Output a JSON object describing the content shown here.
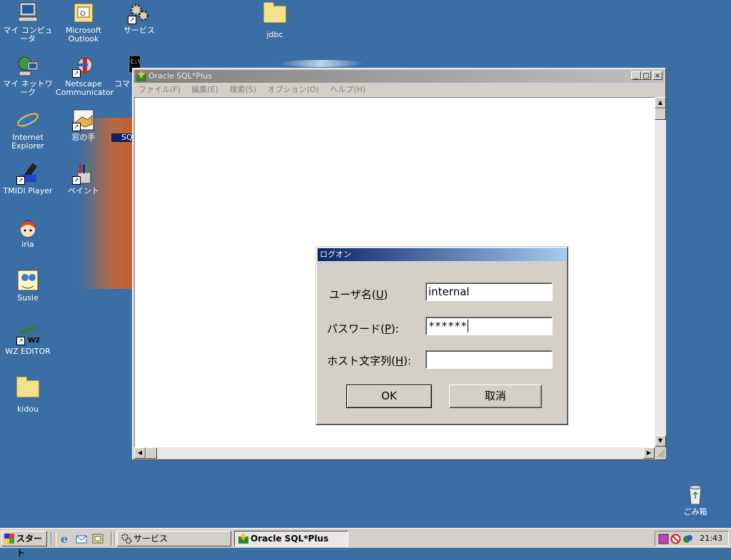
{
  "desktop": {
    "icons": [
      {
        "label": "マイ コンピュータ"
      },
      {
        "label": "マイ ネットワーク"
      },
      {
        "label": "Internet Explorer"
      },
      {
        "label": "TMIDI Player"
      },
      {
        "label": "iria"
      },
      {
        "label": "Susie"
      },
      {
        "label": "WZ EDITOR"
      },
      {
        "label": "kidou"
      },
      {
        "label": "Microsoft Outlook"
      },
      {
        "label": "Netscape Communicator"
      },
      {
        "label": "窓の手"
      },
      {
        "label": "ペイント"
      },
      {
        "label": "サービス"
      },
      {
        "label": "コマ"
      },
      {
        "label": "SQ"
      },
      {
        "label": "jdbc"
      },
      {
        "label": "ごみ箱"
      }
    ]
  },
  "window": {
    "title": "Oracle SQL*Plus",
    "menu": [
      "ファイル(F)",
      "編集(E)",
      "検索(S)",
      "オプション(O)",
      "ヘルプ(H)"
    ],
    "controls": {
      "minimize": "_",
      "maximize": "□",
      "close": "×"
    }
  },
  "dialog": {
    "title": "ログオン",
    "fields": {
      "username": {
        "label_pre": "ユーザ名(",
        "key": "U",
        "label_post": ")",
        "value": "internal"
      },
      "password": {
        "label_pre": "パスワード(",
        "key": "P",
        "label_post": "):",
        "value": "******"
      },
      "host": {
        "label_pre": "ホスト文字列(",
        "key": "H",
        "label_post": "):",
        "value": ""
      }
    },
    "ok_label": "OK",
    "cancel_label": "取消"
  },
  "taskbar": {
    "start_label": "スタート",
    "tasks": [
      {
        "label": "サービス"
      },
      {
        "label": "Oracle SQL*Plus"
      }
    ],
    "clock": "21:43"
  },
  "colors": {
    "desktop": "#3a6ea5",
    "dialog_title_start": "#0a246a",
    "dialog_title_end": "#a6caf0"
  }
}
